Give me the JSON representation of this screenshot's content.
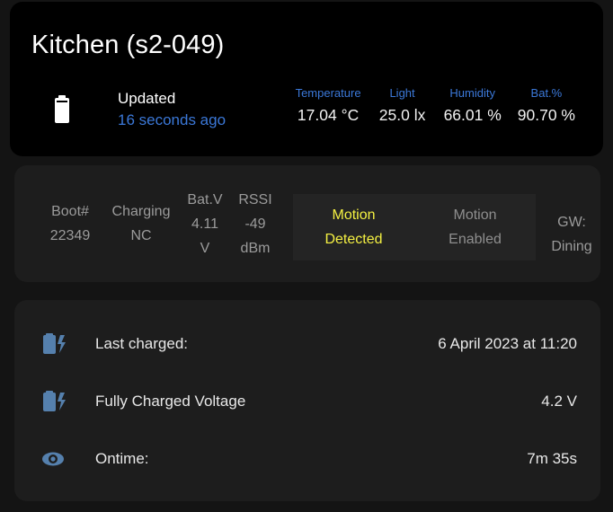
{
  "theme": {
    "page_bg": "#141414",
    "header_card_bg": "#000000",
    "card_bg": "#1d1d1d",
    "panel_bg": "#242424",
    "accent_blue": "#3b78d8",
    "icon_blue": "#5580ad",
    "alert_yellow": "#f5f142",
    "muted_gray": "#9b9b9b",
    "text_white": "#f2f2f2"
  },
  "header": {
    "title": "Kitchen (s2-049)",
    "battery_icon": "battery-full-icon",
    "updated_label": "Updated",
    "updated_value": "16 seconds ago",
    "metrics": [
      {
        "label": "Temperature",
        "value": "17.04 °C"
      },
      {
        "label": "Light",
        "value": "25.0 lx"
      },
      {
        "label": "Humidity",
        "value": "66.01 %"
      },
      {
        "label": "Bat.%",
        "value": "90.70 %"
      }
    ]
  },
  "status": {
    "columns": [
      {
        "key": "Boot#",
        "value": "22349"
      },
      {
        "key": "Charging",
        "value": "NC"
      },
      {
        "key": "Bat.V",
        "value": "4.11",
        "unit": "V"
      },
      {
        "key": "RSSI",
        "value": "-49",
        "unit": "dBm"
      }
    ],
    "motion": {
      "detected_line1": "Motion",
      "detected_line2": "Detected",
      "enabled_line1": "Motion",
      "enabled_line2": "Enabled"
    },
    "gateway": {
      "label": "GW:",
      "value": "Dining"
    }
  },
  "details": {
    "rows": [
      {
        "icon": "battery-charging-icon",
        "label": "Last charged:",
        "value": "6 April 2023 at 11:20"
      },
      {
        "icon": "battery-charging-icon",
        "label": "Fully Charged Voltage",
        "value": "4.2 V"
      },
      {
        "icon": "eye-icon",
        "label": "Ontime:",
        "value": "7m 35s"
      }
    ]
  }
}
